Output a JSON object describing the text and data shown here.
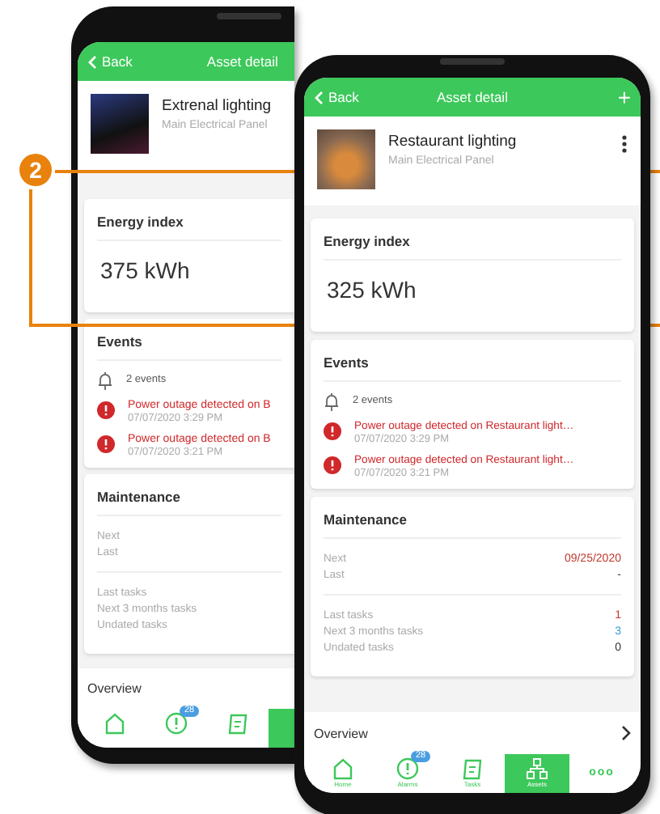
{
  "callout": {
    "number": "2"
  },
  "phones": [
    {
      "header": {
        "back": "Back",
        "title": "Asset detail"
      },
      "asset": {
        "name": "Extrenal lighting",
        "subtitle": "Main Electrical Panel"
      },
      "energy": {
        "title": "Energy index",
        "value": "375 kWh"
      },
      "events": {
        "title": "Events",
        "summary": "2 events",
        "items": [
          {
            "message": "Power outage detected on B",
            "time": "07/07/2020 3:29 PM"
          },
          {
            "message": "Power outage detected on B",
            "time": "07/07/2020 3:21 PM"
          }
        ]
      },
      "maintenance": {
        "title": "Maintenance",
        "dates": [
          {
            "label": "Next"
          },
          {
            "label": "Last"
          }
        ],
        "tasks": [
          {
            "label": "Last tasks"
          },
          {
            "label": "Next 3 months tasks"
          },
          {
            "label": "Undated tasks"
          }
        ]
      },
      "overview": {
        "label": "Overview"
      },
      "tabs": [
        {
          "kind": "home",
          "selected": false
        },
        {
          "kind": "alarms",
          "badge": "28",
          "selected": false
        },
        {
          "kind": "tasks",
          "selected": false
        },
        {
          "kind": "assets",
          "selected": true
        }
      ]
    },
    {
      "header": {
        "back": "Back",
        "title": "Asset detail",
        "action": "+"
      },
      "asset": {
        "name": "Restaurant lighting",
        "subtitle": "Main Electrical Panel",
        "menu": true
      },
      "energy": {
        "title": "Energy index",
        "value": "325 kWh"
      },
      "events": {
        "title": "Events",
        "summary": "2 events",
        "items": [
          {
            "message": "Power outage detected on Restaurant light…",
            "time": "07/07/2020 3:29 PM"
          },
          {
            "message": "Power outage detected on Restaurant light…",
            "time": "07/07/2020 3:21 PM"
          }
        ]
      },
      "maintenance": {
        "title": "Maintenance",
        "dates": [
          {
            "label": "Next",
            "value": "09/25/2020",
            "color": "#c0392b"
          },
          {
            "label": "Last",
            "value": "-"
          }
        ],
        "tasks": [
          {
            "label": "Last tasks",
            "value": "1",
            "color": "#c0392b"
          },
          {
            "label": "Next 3 months tasks",
            "value": "3",
            "color": "#3a9ad9"
          },
          {
            "label": "Undated tasks",
            "value": "0"
          }
        ]
      },
      "overview": {
        "label": "Overview",
        "chevron": true
      },
      "tabs": [
        {
          "kind": "home",
          "label": "Home",
          "selected": false
        },
        {
          "kind": "alarms",
          "label": "Alarms",
          "badge": "28",
          "selected": false
        },
        {
          "kind": "tasks",
          "label": "Tasks",
          "selected": false
        },
        {
          "kind": "assets",
          "label": "Assets",
          "selected": true
        },
        {
          "kind": "more",
          "label": "ooo",
          "selected": false
        }
      ]
    }
  ]
}
